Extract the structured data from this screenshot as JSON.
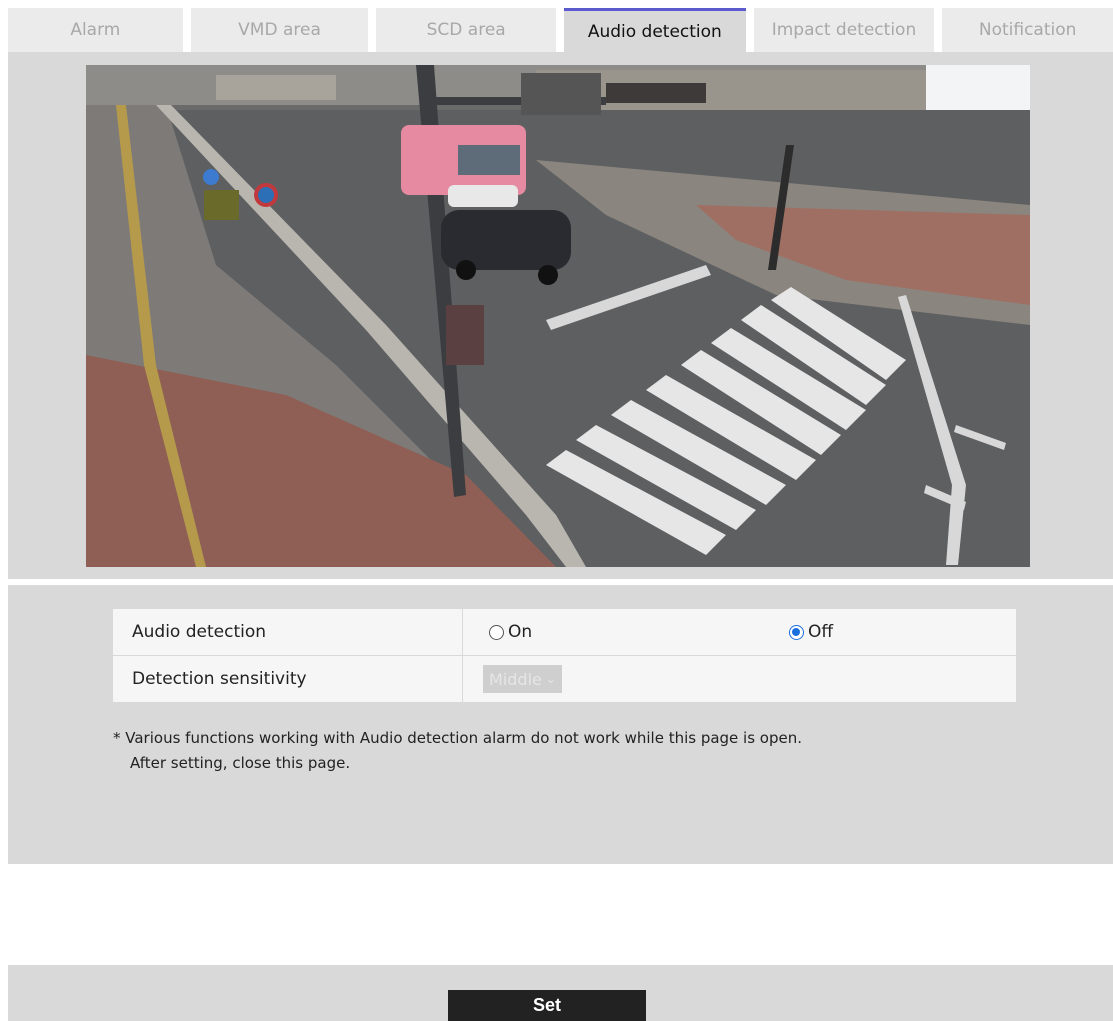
{
  "tabs": [
    {
      "label": "Alarm"
    },
    {
      "label": "VMD area"
    },
    {
      "label": "SCD area"
    },
    {
      "label": "Audio detection"
    },
    {
      "label": "Impact detection"
    },
    {
      "label": "Notification"
    }
  ],
  "active_tab": "Audio detection",
  "settings": {
    "audio_detection": {
      "label": "Audio detection",
      "on_label": "On",
      "off_label": "Off",
      "selected": "Off"
    },
    "sensitivity": {
      "label": "Detection sensitivity",
      "value": "Middle",
      "disabled": true
    }
  },
  "note": {
    "line1": "* Various functions working with Audio detection alarm do not work while this page is open.",
    "line2": "After setting, close this page."
  },
  "set_button": "Set",
  "colors": {
    "active_tab_border": "#5b5bcf",
    "panel_bg": "#d9d9d9",
    "radio_checked": "#1a6fe0",
    "set_button_bg": "#222222"
  }
}
